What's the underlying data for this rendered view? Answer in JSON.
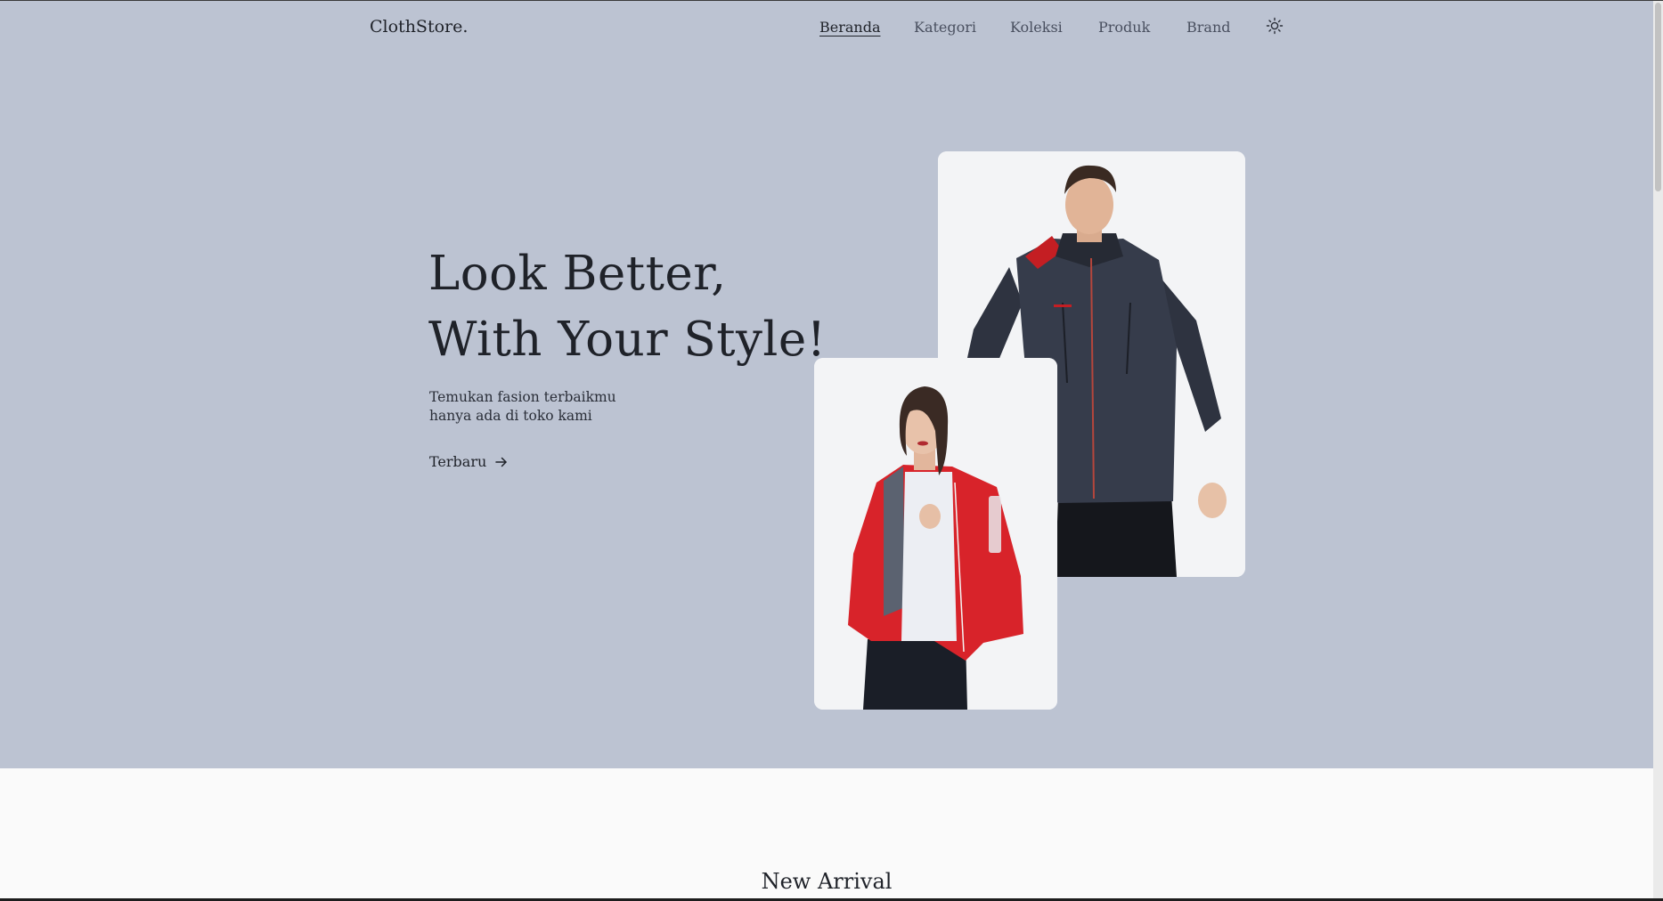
{
  "header": {
    "logo": "ClothStore.",
    "nav": [
      {
        "label": "Beranda",
        "active": true
      },
      {
        "label": "Kategori",
        "active": false
      },
      {
        "label": "Koleksi",
        "active": false
      },
      {
        "label": "Produk",
        "active": false
      },
      {
        "label": "Brand",
        "active": false
      }
    ],
    "theme_toggle_icon": "sun-icon"
  },
  "hero": {
    "headline_line1": "Look Better,",
    "headline_line2": "With Your Style!",
    "subtitle_line1": "Temukan fasion terbaikmu",
    "subtitle_line2": "hanya ada di toko kami",
    "cta_label": "Terbaru",
    "cta_icon": "arrow-right-icon",
    "background_color": "#bcc3d2",
    "images": [
      {
        "name": "man-dark-jacket-photo"
      },
      {
        "name": "woman-red-jacket-photo"
      }
    ]
  },
  "sections": {
    "new_arrival_title": "New Arrival"
  }
}
